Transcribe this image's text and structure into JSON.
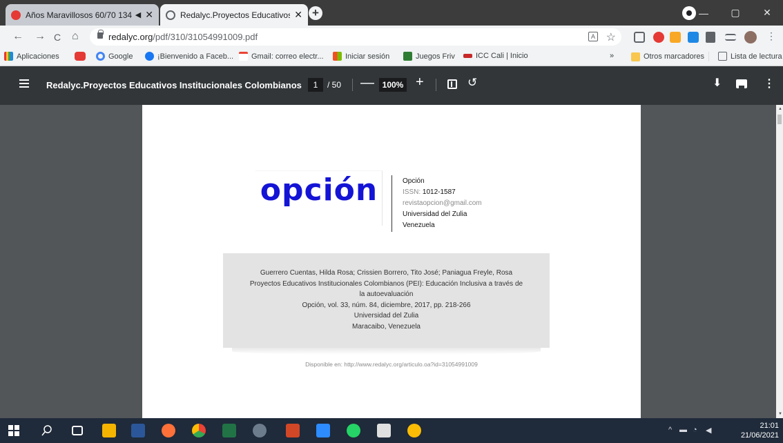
{
  "browser": {
    "tabs": [
      {
        "title": "Años Maravillosos 60/70 134",
        "active": false
      },
      {
        "title": "Redalyc.Proyectos Educativos Ins",
        "active": true
      }
    ],
    "new_tab_label": "+",
    "window_controls": {
      "minimize": "—",
      "maximize": "▢",
      "close": "✕"
    },
    "close_tab": "✕",
    "audio_icon": "◀"
  },
  "address": {
    "domain": "redalyc.org",
    "path": "/pdf/310/31054991009.pdf",
    "back": "←",
    "forward": "→",
    "reload": "C",
    "home": "⌂",
    "star": "☆",
    "translate": "A"
  },
  "bookmarks": {
    "items": [
      "Aplicaciones",
      "Google",
      "¡Bienvenido a Faceb...",
      "Gmail: correo electr...",
      "Iniciar sesión",
      "Juegos Friv",
      "ICC Cali | Inicio"
    ],
    "overflow": "»",
    "other": "Otros marcadores",
    "reading_list": "Lista de lectura"
  },
  "pdf_toolbar": {
    "title": "Redalyc.Proyectos Educativos Institucionales Colombianos (PE...",
    "page_current": "1",
    "page_total": "/ 50",
    "zoom": "100%",
    "zoom_out": "—",
    "zoom_in": "+",
    "rotate": "↺",
    "download": "⬇",
    "more": "⋮"
  },
  "document": {
    "logo": "opción",
    "journal": "Opción",
    "issn_label": "ISSN:",
    "issn": "1012-1587",
    "email": "revistaopcion@gmail.com",
    "university": "Universidad del Zulia",
    "country": "Venezuela",
    "citation": [
      "Guerrero Cuentas, Hilda Rosa; Crissien Borrero, Tito José; Paniagua Freyle, Rosa",
      "Proyectos Educativos Institucionales Colombianos (PEI): Educación Inclusiva a través de",
      "la autoevaluación",
      "Opción, vol. 33, núm. 84, diciembre, 2017, pp. 218-266",
      "Universidad del Zulia",
      "Maracaibo, Venezuela"
    ],
    "available": "Disponible en: http://www.redalyc.org/articulo.oa?id=31054991009"
  },
  "taskbar": {
    "time": "21:01",
    "date": "21/06/2021",
    "tray_chevron": "^"
  },
  "colors": {
    "logo_blue": "#1414d6",
    "pdf_toolbar": "#323639",
    "viewer_bg": "#525659",
    "taskbar": "#1f2a3a"
  }
}
